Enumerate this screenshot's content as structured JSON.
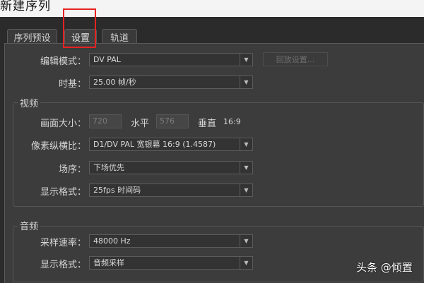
{
  "window": {
    "title": "新建序列"
  },
  "tabs": [
    {
      "label": "序列预设",
      "active": false
    },
    {
      "label": "设置",
      "active": true
    },
    {
      "label": "轨道",
      "active": false
    }
  ],
  "general": {
    "edit_mode_label": "编辑模式：",
    "edit_mode_value": "DV PAL",
    "playback_settings_label": "回放设置...",
    "timebase_label": "时基：",
    "timebase_value": "25.00 帧/秒"
  },
  "video": {
    "section_title": "视频",
    "frame_size_label": "画面大小：",
    "frame_width": "720",
    "horizontal_label": "水平",
    "frame_height": "576",
    "vertical_label": "垂直",
    "aspect_ratio": "16:9",
    "pixel_aspect_label": "像素纵横比：",
    "pixel_aspect_value": "D1/DV PAL 宽银幕 16:9 (1.4587)",
    "field_order_label": "场序：",
    "field_order_value": "下场优先",
    "display_format_label": "显示格式：",
    "display_format_value": "25fps 时间码"
  },
  "audio": {
    "section_title": "音频",
    "sample_rate_label": "采样速率：",
    "sample_rate_value": "48000 Hz",
    "display_format_label": "显示格式：",
    "display_format_value": "音频采样"
  },
  "watermark": {
    "text": "头条 @倾置"
  },
  "colors": {
    "highlight": "#e52222",
    "panel": "#3c3c3c",
    "field": "#333333"
  }
}
